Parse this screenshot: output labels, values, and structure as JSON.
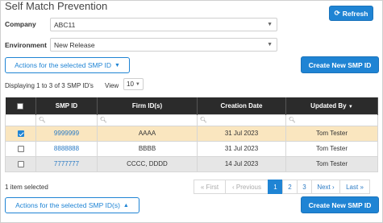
{
  "page": {
    "title": "Self Match Prevention"
  },
  "header": {
    "refresh_label": "Refresh"
  },
  "form": {
    "company": {
      "label": "Company",
      "value": "ABC11"
    },
    "environment": {
      "label": "Environment",
      "value": "New Release"
    }
  },
  "actions": {
    "top_label": "Actions for the selected SMP ID",
    "bottom_label": "Actions for the selected SMP ID(s)",
    "create_label": "Create New SMP ID"
  },
  "summary": {
    "prefix": "Displaying ",
    "start": "1",
    "middle": " to ",
    "end": "3",
    "of": " of ",
    "total": "3",
    "suffix": " SMP ID's",
    "view_label": "View",
    "view_value": "10"
  },
  "table": {
    "columns": [
      "SMP ID",
      "Firm ID(s)",
      "Creation Date",
      "Updated By"
    ],
    "rows": [
      {
        "checked": true,
        "smp_id": "9999999",
        "firm_ids": "AAAA",
        "creation_date": "31 Jul 2023",
        "updated_by": "Tom Tester"
      },
      {
        "checked": false,
        "smp_id": "8888888",
        "firm_ids": "BBBB",
        "creation_date": "31 Jul 2023",
        "updated_by": "Tom Tester"
      },
      {
        "checked": false,
        "smp_id": "7777777",
        "firm_ids": "CCCC, DDDD",
        "creation_date": "14 Jul 2023",
        "updated_by": "Tom Tester"
      }
    ]
  },
  "footer": {
    "selected_count": "1",
    "selected_label": " item selected"
  },
  "pagination": {
    "first": "« First",
    "previous": "‹ Previous",
    "pages": [
      "1",
      "2",
      "3"
    ],
    "current_page": "1",
    "next": "Next ›",
    "last": "Last »"
  },
  "colors": {
    "accent": "#1f84d4",
    "header_bg": "#2b2b2b",
    "selected_row": "#fae6bf",
    "link": "#2a7ac4"
  },
  "icons": {
    "refresh": "refresh-icon",
    "dropdown": "caret-down-icon",
    "search": "search-icon"
  }
}
